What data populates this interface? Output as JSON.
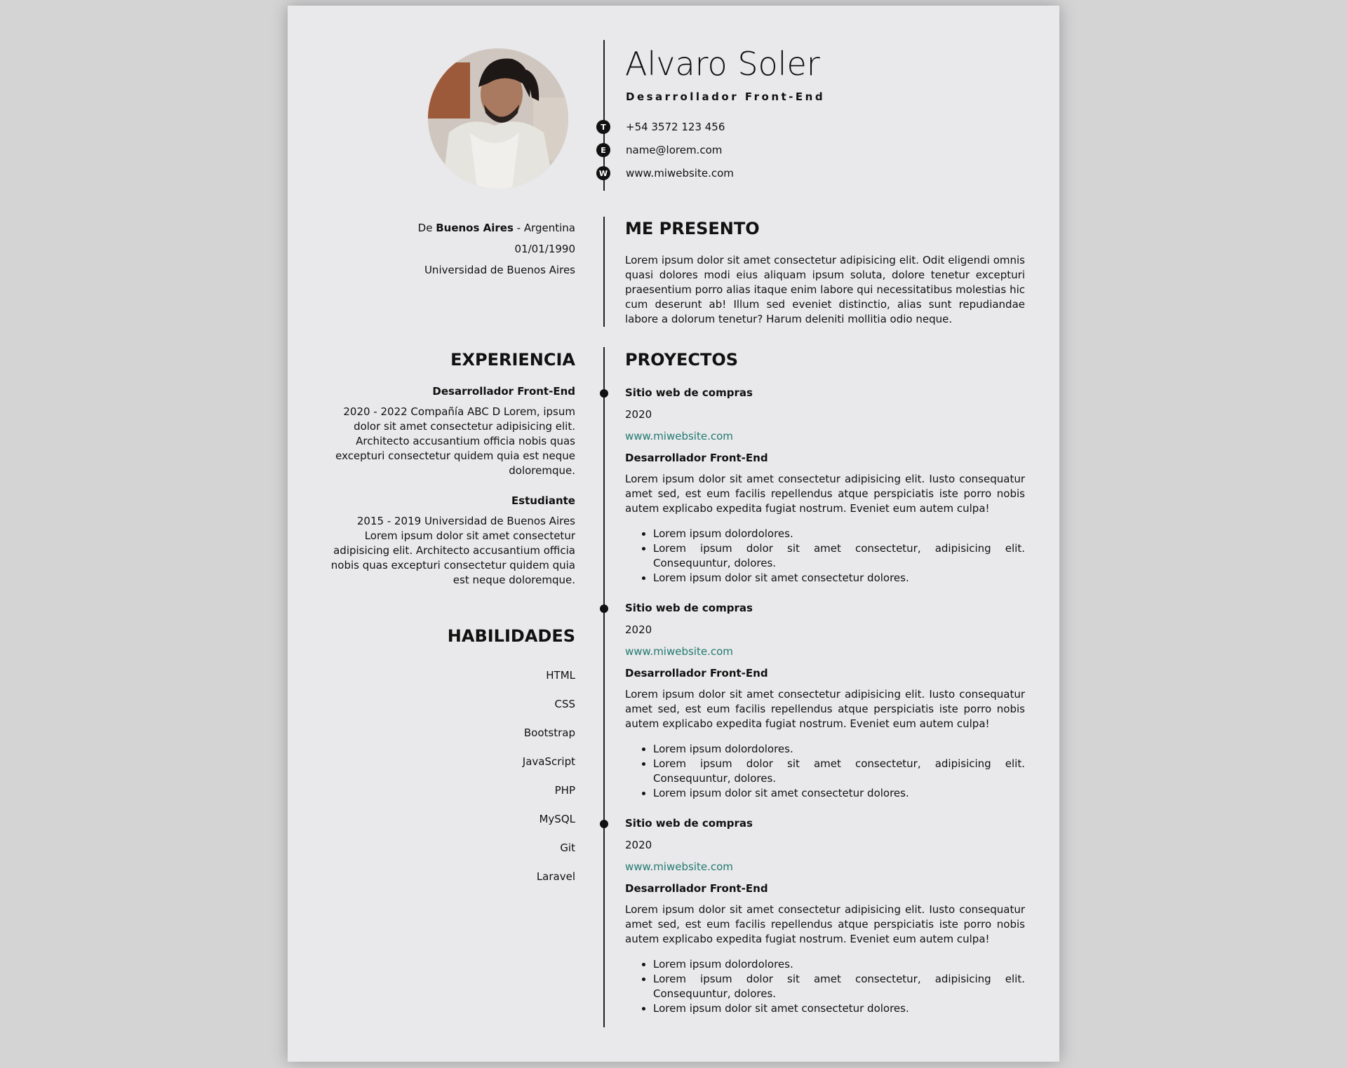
{
  "header": {
    "name": "Alvaro Soler",
    "role": "Desarrollador Front-End",
    "contacts": [
      {
        "letter": "T",
        "text": "+54 3572 123 456"
      },
      {
        "letter": "E",
        "text": "name@lorem.com"
      },
      {
        "letter": "W",
        "text": "www.miwebsite.com"
      }
    ]
  },
  "personal": {
    "origin_prefix": "De ",
    "origin_city": "Buenos Aires",
    "origin_suffix": " - Argentina",
    "birthdate": "01/01/1990",
    "university": "Universidad de Buenos Aires"
  },
  "about": {
    "title": "ME PRESENTO",
    "text": "Lorem ipsum dolor sit amet consectetur adipisicing elit. Odit eligendi omnis quasi dolores modi eius aliquam ipsum soluta, dolore tenetur excepturi praesentium porro alias itaque enim labore qui necessitatibus molestias hic cum deserunt ab! Illum sed eveniet distinctio, alias sunt repudiandae labore a dolorum tenetur? Harum deleniti mollitia odio neque."
  },
  "experience": {
    "title": "EXPERIENCIA",
    "items": [
      {
        "role": "Desarrollador Front-End",
        "text": "2020 - 2022 Compañía ABC D Lorem, ipsum dolor sit amet consectetur adipisicing elit. Architecto accusantium officia nobis quas excepturi consectetur quidem quia est neque doloremque."
      },
      {
        "role": "Estudiante",
        "text": "2015 - 2019 Universidad de Buenos Aires Lorem ipsum dolor sit amet consectetur adipisicing elit. Architecto accusantium officia nobis quas excepturi consectetur quidem quia est neque doloremque."
      }
    ]
  },
  "skills": {
    "title": "HABILIDADES",
    "items": [
      "HTML",
      "CSS",
      "Bootstrap",
      "JavaScript",
      "PHP",
      "MySQL",
      "Git",
      "Laravel"
    ]
  },
  "projects": {
    "title": "PROYECTOS",
    "items": [
      {
        "title": "Sitio web de compras",
        "year": "2020",
        "link": "www.miwebsite.com",
        "role": "Desarrollador Front-End",
        "desc": "Lorem ipsum dolor sit amet consectetur adipisicing elit. Iusto consequatur amet sed, est eum facilis repellendus atque perspiciatis iste porro nobis autem explicabo expedita fugiat nostrum. Eveniet eum autem culpa!",
        "bullets": [
          "Lorem ipsum dolordolores.",
          "Lorem ipsum dolor sit amet consectetur, adipisicing elit. Consequuntur, dolores.",
          "Lorem ipsum dolor sit amet consectetur dolores."
        ]
      },
      {
        "title": "Sitio web de compras",
        "year": "2020",
        "link": "www.miwebsite.com",
        "role": "Desarrollador Front-End",
        "desc": "Lorem ipsum dolor sit amet consectetur adipisicing elit. Iusto consequatur amet sed, est eum facilis repellendus atque perspiciatis iste porro nobis autem explicabo expedita fugiat nostrum. Eveniet eum autem culpa!",
        "bullets": [
          "Lorem ipsum dolordolores.",
          "Lorem ipsum dolor sit amet consectetur, adipisicing elit. Consequuntur, dolores.",
          "Lorem ipsum dolor sit amet consectetur dolores."
        ]
      },
      {
        "title": "Sitio web de compras",
        "year": "2020",
        "link": "www.miwebsite.com",
        "role": "Desarrollador Front-End",
        "desc": "Lorem ipsum dolor sit amet consectetur adipisicing elit. Iusto consequatur amet sed, est eum facilis repellendus atque perspiciatis iste porro nobis autem explicabo expedita fugiat nostrum. Eveniet eum autem culpa!",
        "bullets": [
          "Lorem ipsum dolordolores.",
          "Lorem ipsum dolor sit amet consectetur, adipisicing elit. Consequuntur, dolores.",
          "Lorem ipsum dolor sit amet consectetur dolores."
        ]
      }
    ]
  },
  "colors": {
    "page_bg": "#e9e8ea",
    "backdrop": "#d4d4d5",
    "link": "#1f7a73",
    "text": "#111111"
  }
}
